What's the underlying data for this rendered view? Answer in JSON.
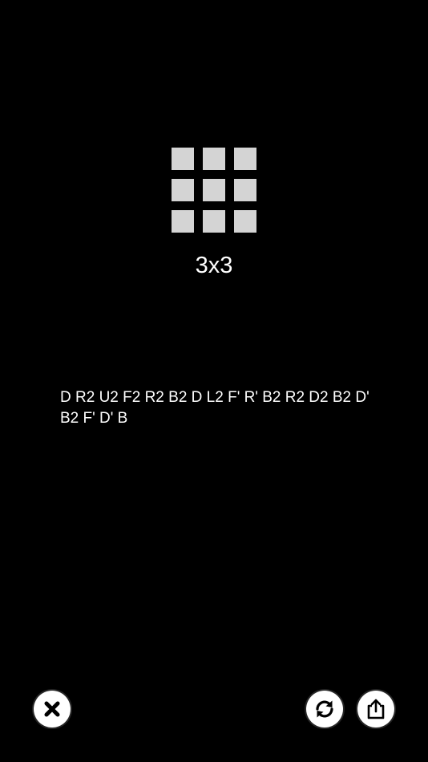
{
  "puzzle": {
    "icon": "3x3-grid-icon",
    "label": "3x3",
    "cell_color": "#d4d4d4"
  },
  "scramble": {
    "text": "D R2 U2 F2 R2 B2 D L2 F' R' B2 R2 D2 B2 D' B2 F' D' B"
  },
  "buttons": {
    "close_icon": "close-icon",
    "refresh_icon": "refresh-icon",
    "share_icon": "share-icon"
  },
  "colors": {
    "background": "#000000",
    "text": "#ffffff",
    "button_bg": "#ffffff",
    "button_icon": "#000000"
  }
}
